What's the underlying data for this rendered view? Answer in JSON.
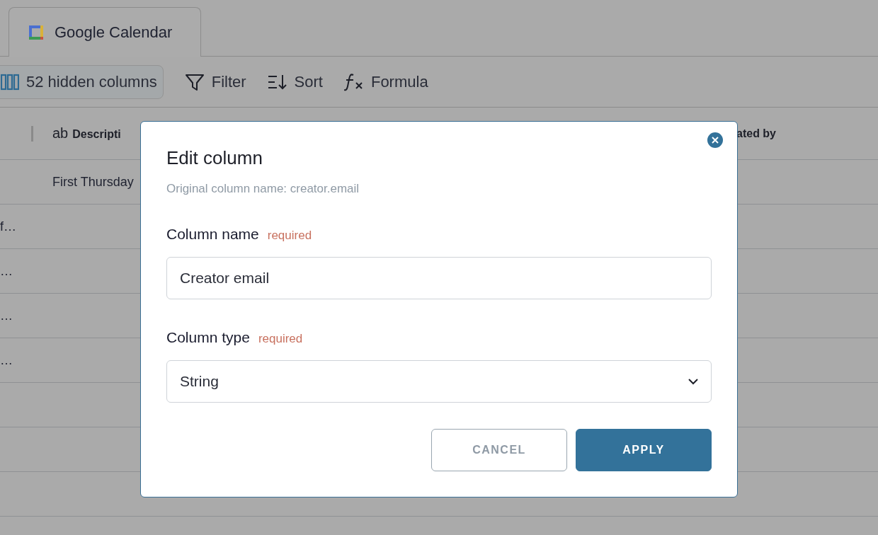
{
  "tabs": [
    {
      "label": "Google Calendar",
      "selected": true
    }
  ],
  "toolbar": {
    "hidden_columns": "52 hidden columns",
    "filter": "Filter",
    "sort": "Sort",
    "formula": "Formula"
  },
  "table": {
    "columns": [
      {
        "type_icon": "ab",
        "label": "Descripti"
      },
      {
        "label": "ated by"
      }
    ],
    "rows": [
      {
        "description": "First Thursday"
      },
      {
        "column_1": "f…"
      },
      {
        "column_1": "…"
      },
      {
        "column_1": "…"
      },
      {
        "column_1": "…"
      },
      {},
      {},
      {},
      {}
    ]
  },
  "dialog": {
    "title": "Edit column",
    "subtitle": "Original column name: creator.email",
    "fields": [
      {
        "kind": "text",
        "label": "Column name",
        "hint": "required",
        "value": "Creator email"
      },
      {
        "kind": "select",
        "label": "Column type",
        "hint": "required",
        "value": "String"
      }
    ],
    "buttons": [
      {
        "kind": "secondary",
        "label": "CANCEL"
      },
      {
        "kind": "primary",
        "label": "APPLY"
      }
    ]
  }
}
